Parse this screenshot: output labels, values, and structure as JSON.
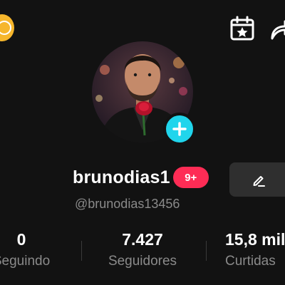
{
  "header": {
    "coin_icon": "coin-icon",
    "calendar_icon": "calendar-star-icon",
    "share_icon": "share-icon"
  },
  "profile": {
    "username": "brunodias1",
    "notification_badge": "9+",
    "handle": "@brunodias13456",
    "add_icon": "plus-icon",
    "edit_icon": "pencil-icon"
  },
  "stats": {
    "following": {
      "value": "0",
      "label": "Seguindo"
    },
    "followers": {
      "value": "7.427",
      "label": "Seguidores"
    },
    "likes": {
      "value": "15,8 mil",
      "label": "Curtidas"
    }
  },
  "colors": {
    "background": "#121212",
    "coin": "#f6b62c",
    "plus_button": "#20d5ec",
    "badge": "#fe2c55",
    "edit_button": "#2f2f2f",
    "secondary_text": "#8a8a8a"
  }
}
